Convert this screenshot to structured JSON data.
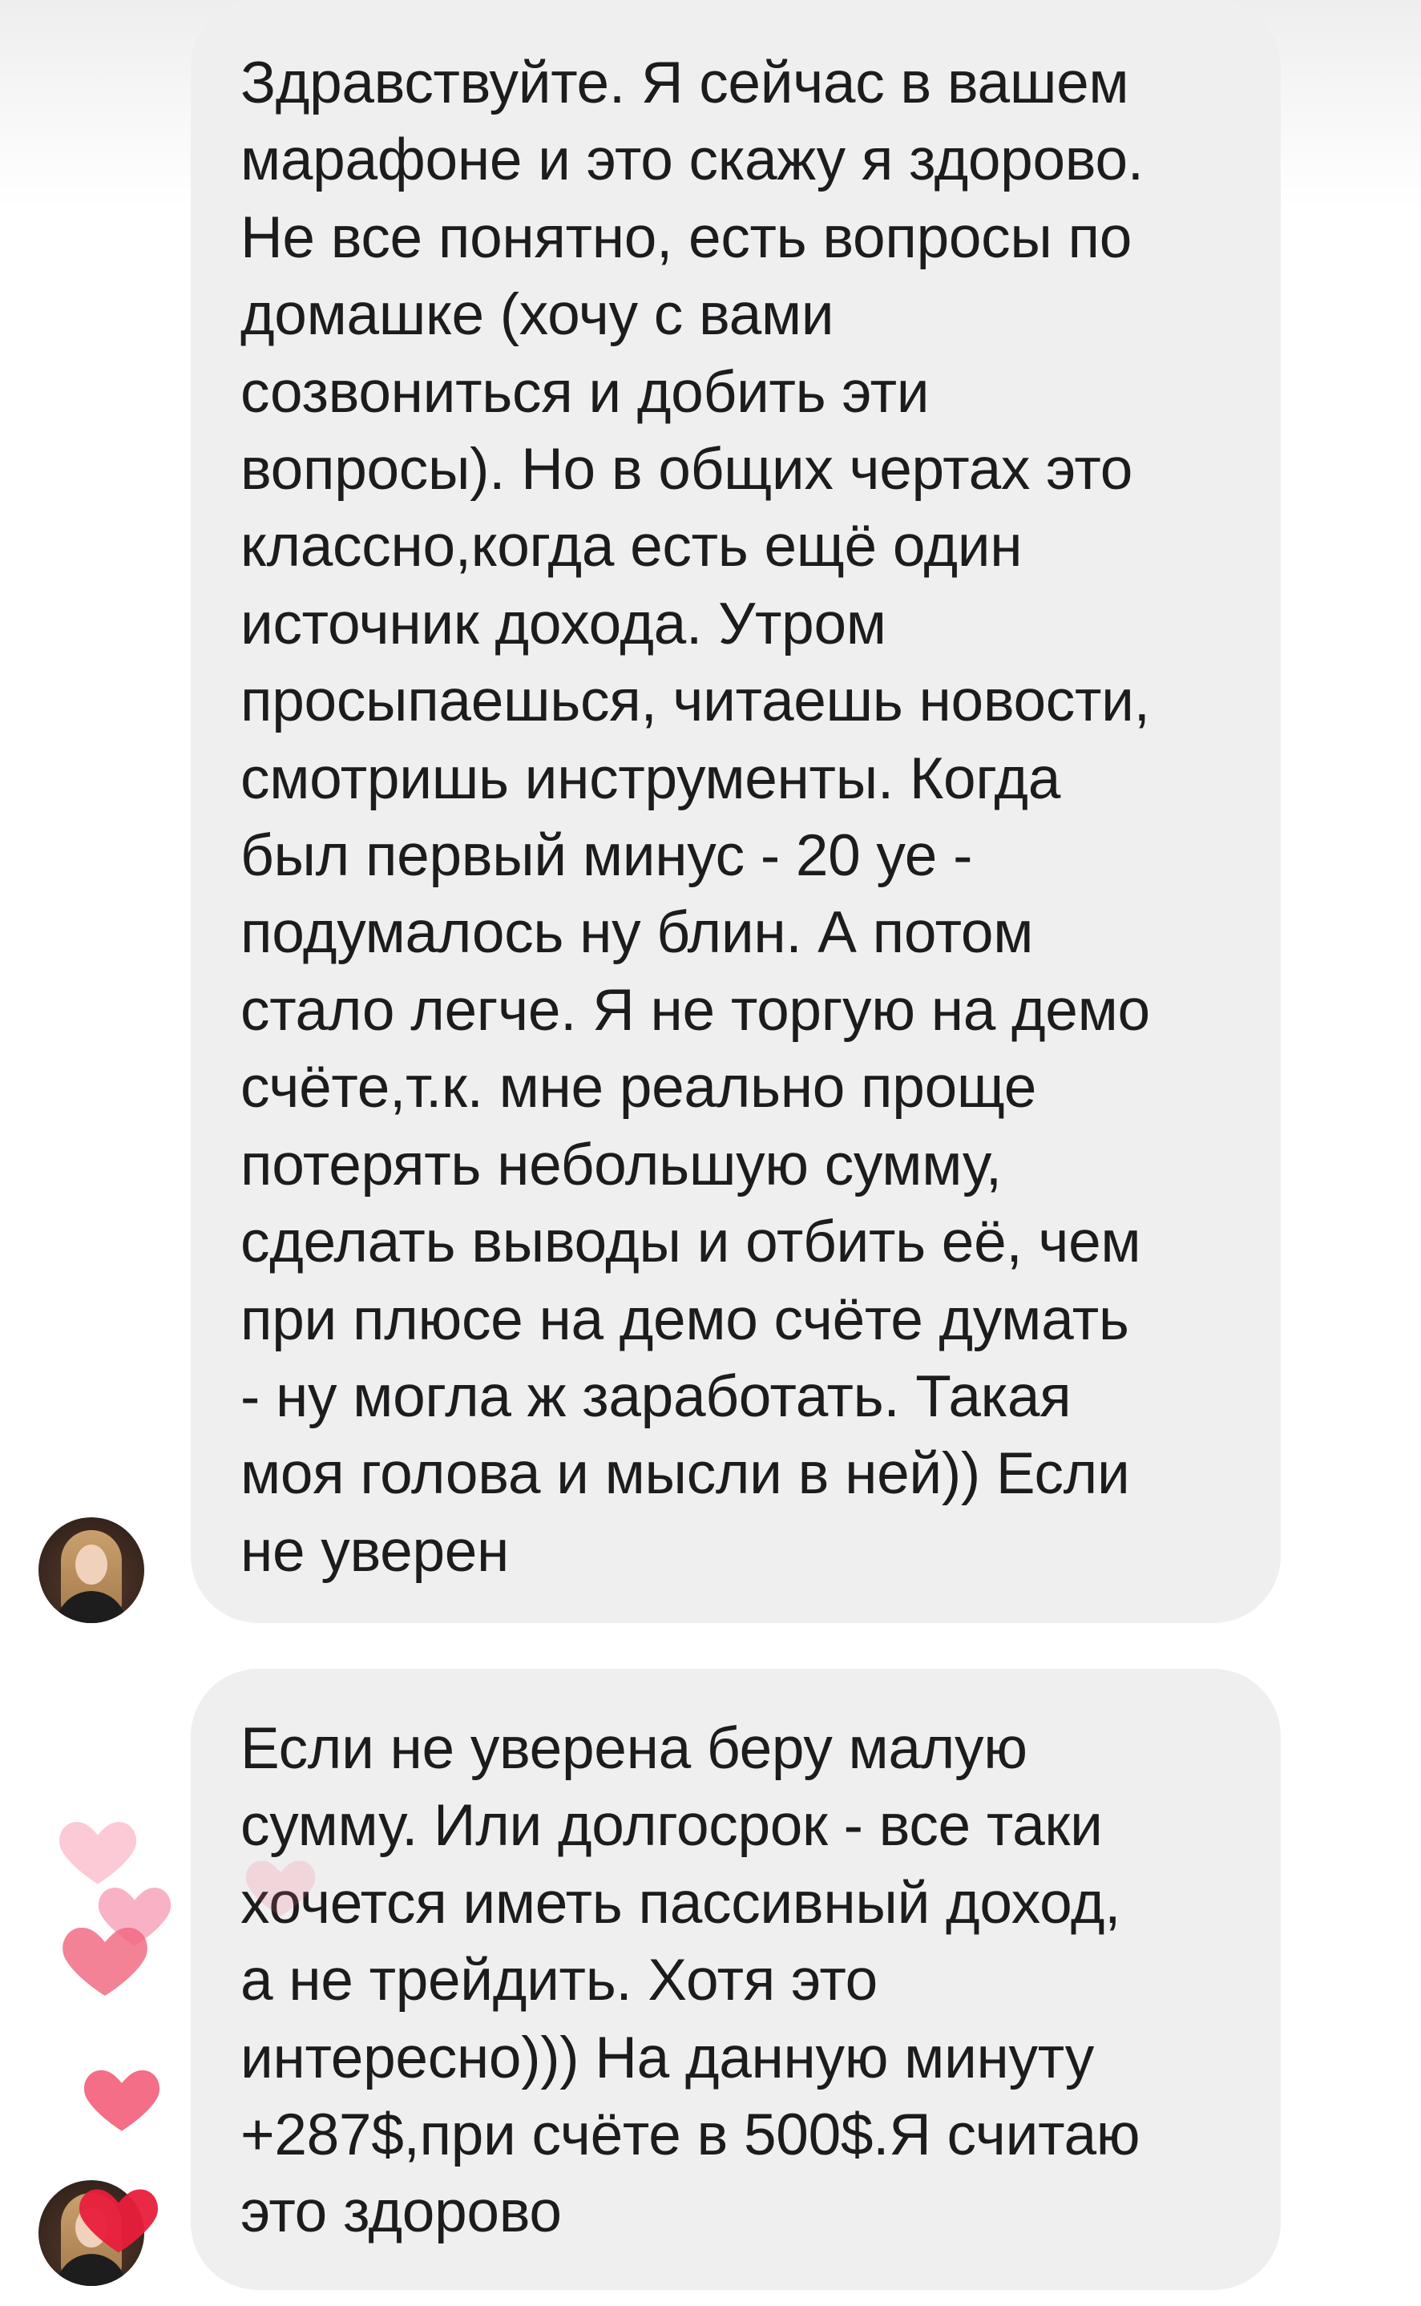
{
  "messages": [
    {
      "lines": [
        "Здравствуйте. Я сейчас в вашем",
        "марафоне и это скажу я здорово.",
        "Не все понятно, есть вопросы по",
        "домашке (хочу с вами",
        "созвониться и добить эти",
        "вопросы). Но в общих чертах это",
        "классно,когда есть ещё один",
        "источник дохода. Утром",
        "просыпаешься, читаешь новости,",
        "смотришь инструменты. Когда",
        "был первый минус - 20 уе -",
        "подумалось ну блин. А потом",
        "стало легче. Я не торгую на демо",
        "счёте,т.к. мне реально проще",
        "потерять небольшую сумму,",
        "сделать выводы и отбить её, чем",
        "при плюсе на демо счёте думать",
        "- ну могла ж заработать. Такая",
        "моя голова и мысли в ней)) Если",
        "не уверен"
      ]
    },
    {
      "lines": [
        "Если не уверена беру малую",
        "сумму. Или долгосрок - все таки",
        "хочется иметь пассивный доход,",
        "а не трейдить. Хотя это",
        "интересно))) На данную минуту",
        "+287$,при счёте в 500$.Я считаю",
        "это здорово"
      ]
    }
  ],
  "reactions": {
    "icon": "heart-icon",
    "colors": [
      "#f9b8c8",
      "#f792ad",
      "#f2667f",
      "#e91e3c"
    ]
  },
  "style": {
    "bubble_color": "#efefef",
    "text_color": "#1c1c1e"
  }
}
